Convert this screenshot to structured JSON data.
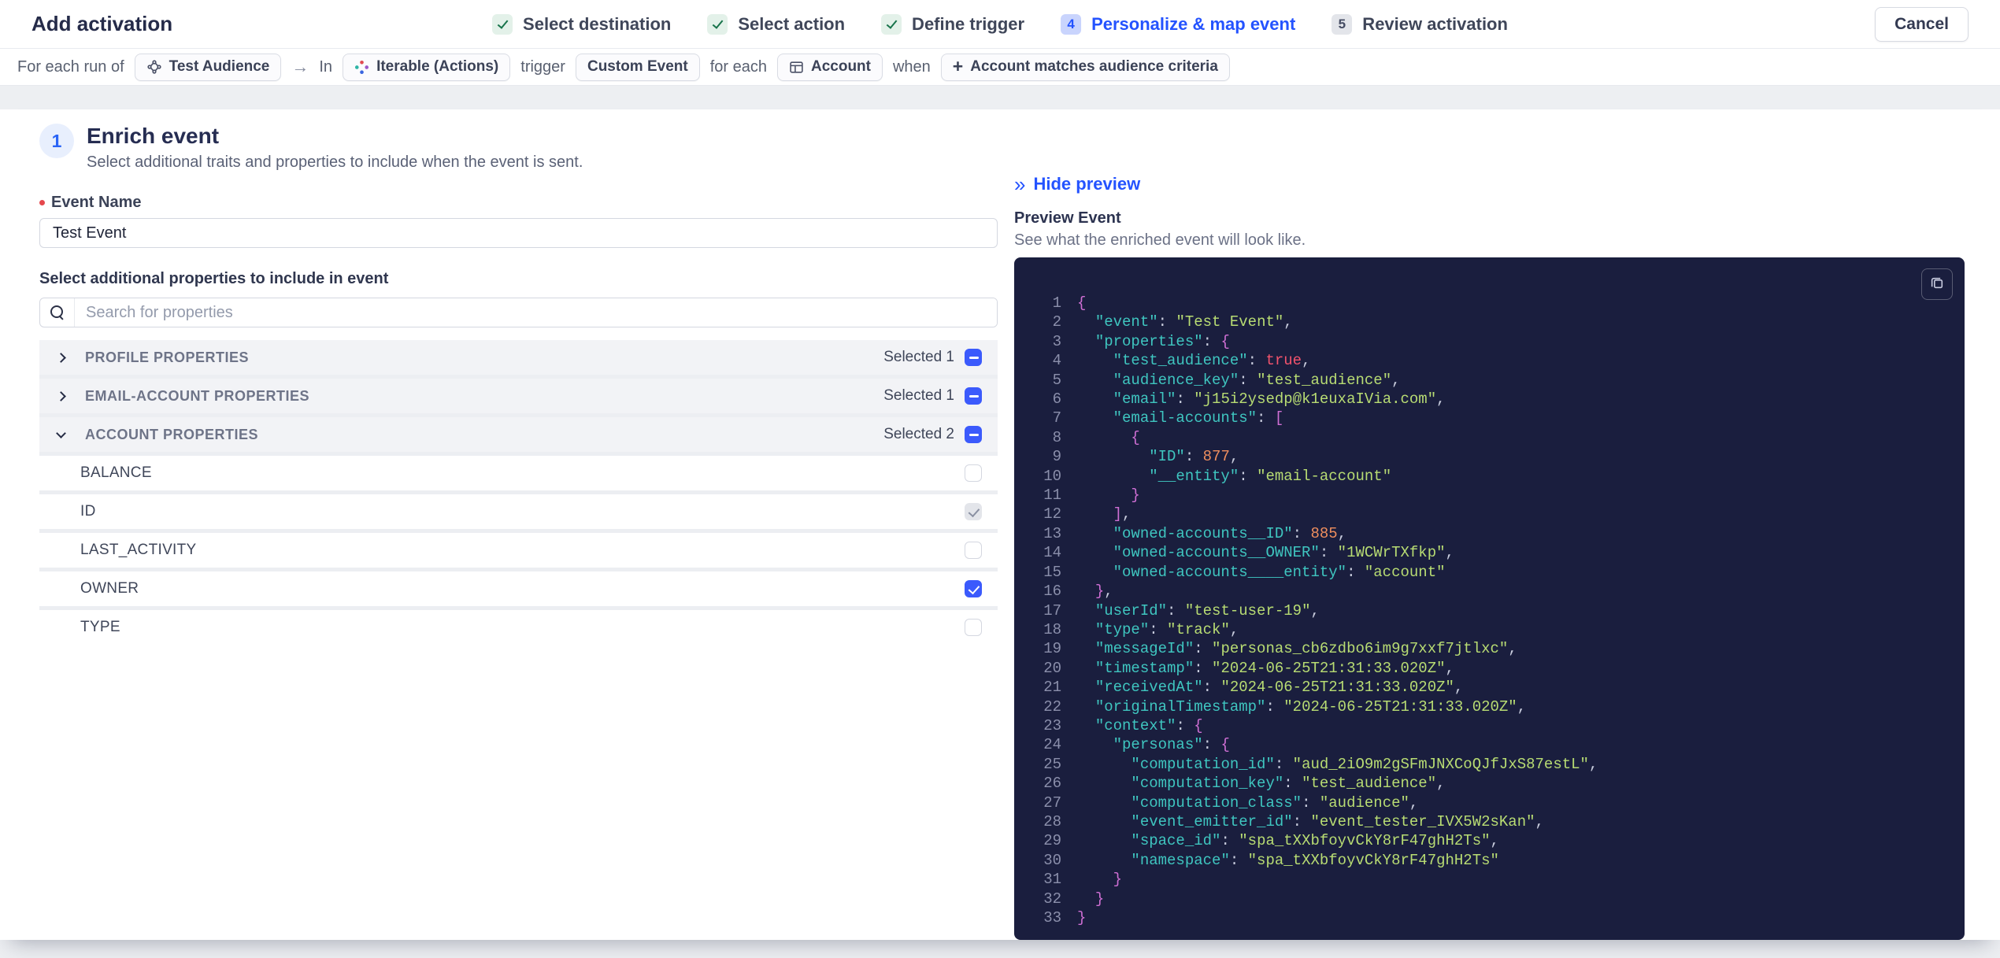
{
  "colors": {
    "accent": "#3b5afc",
    "link": "#2453ff",
    "red_required": "#e5484d",
    "step_done_bg": "#e3f1e9",
    "step_done_check": "#17734a",
    "step_active_bg": "#c9d4fd",
    "step_todo_bg": "#e3e5ea",
    "code_bg": "#1a1e3e",
    "tok_key": "#3fc6c0",
    "tok_string": "#b8dc73",
    "tok_number": "#ef8e5e",
    "tok_boolean": "#f2536d",
    "tok_punct": "#cf6fd4",
    "tok_delim": "#c9cdde",
    "tok_linenum": "#8b8fab"
  },
  "header": {
    "title": "Add activation",
    "cancel_label": "Cancel",
    "steps": [
      {
        "label": "Select destination",
        "state": "done"
      },
      {
        "label": "Select action",
        "state": "done"
      },
      {
        "label": "Define trigger",
        "state": "done"
      },
      {
        "label": "Personalize & map event",
        "state": "active",
        "number": "4"
      },
      {
        "label": "Review activation",
        "state": "todo",
        "number": "5"
      }
    ]
  },
  "summary_bar": {
    "segments": [
      {
        "type": "label",
        "text": "For each run of"
      },
      {
        "type": "chip",
        "icon": "audience-network-icon",
        "text": "Test Audience"
      },
      {
        "type": "arrow",
        "text": "→"
      },
      {
        "type": "label",
        "text": "In"
      },
      {
        "type": "chip",
        "icon": "iterable-logo-icon",
        "text": "Iterable (Actions)"
      },
      {
        "type": "label",
        "text": "trigger"
      },
      {
        "type": "chip",
        "icon": null,
        "text": "Custom Event"
      },
      {
        "type": "label",
        "text": "for each"
      },
      {
        "type": "chip",
        "icon": "table-grid-icon",
        "text": "Account"
      },
      {
        "type": "label",
        "text": "when"
      },
      {
        "type": "chip",
        "icon": "plus-icon",
        "text": "Account matches audience criteria"
      }
    ]
  },
  "enrich": {
    "step_number": "1",
    "title": "Enrich event",
    "subtitle": "Select additional traits and properties to include when the event is sent.",
    "event_name_label": "Event Name",
    "event_name_value": "Test Event",
    "properties_label": "Select additional properties to include in event",
    "search_placeholder": "Search for properties",
    "groups": [
      {
        "label": "PROFILE PROPERTIES",
        "selected_text": "Selected 1",
        "expanded": false
      },
      {
        "label": "EMAIL-ACCOUNT PROPERTIES",
        "selected_text": "Selected 1",
        "expanded": false
      },
      {
        "label": "ACCOUNT PROPERTIES",
        "selected_text": "Selected 2",
        "expanded": true,
        "children": [
          {
            "label": "BALANCE",
            "state": "unchecked"
          },
          {
            "label": "ID",
            "state": "checked-disabled"
          },
          {
            "label": "LAST_ACTIVITY",
            "state": "unchecked"
          },
          {
            "label": "OWNER",
            "state": "checked"
          },
          {
            "label": "TYPE",
            "state": "unchecked"
          }
        ]
      }
    ]
  },
  "preview": {
    "hide_label": "Hide preview",
    "hide_icon": "double-chevron-right-icon",
    "copy_icon": "copy-icon",
    "title": "Preview Event",
    "subtitle": "See what the enriched event will look like.",
    "code_lines": [
      [
        [
          "p",
          "{"
        ]
      ],
      [
        [
          "w",
          "  "
        ],
        [
          "k",
          "\"event\""
        ],
        [
          "d",
          ": "
        ],
        [
          "s",
          "\"Test Event\""
        ],
        [
          "d",
          ","
        ]
      ],
      [
        [
          "w",
          "  "
        ],
        [
          "k",
          "\"properties\""
        ],
        [
          "d",
          ": "
        ],
        [
          "p",
          "{"
        ]
      ],
      [
        [
          "w",
          "    "
        ],
        [
          "k",
          "\"test_audience\""
        ],
        [
          "d",
          ": "
        ],
        [
          "b",
          "true"
        ],
        [
          "d",
          ","
        ]
      ],
      [
        [
          "w",
          "    "
        ],
        [
          "k",
          "\"audience_key\""
        ],
        [
          "d",
          ": "
        ],
        [
          "s",
          "\"test_audience\""
        ],
        [
          "d",
          ","
        ]
      ],
      [
        [
          "w",
          "    "
        ],
        [
          "k",
          "\"email\""
        ],
        [
          "d",
          ": "
        ],
        [
          "s",
          "\"j15i2ysedp@k1euxaIVia.com\""
        ],
        [
          "d",
          ","
        ]
      ],
      [
        [
          "w",
          "    "
        ],
        [
          "k",
          "\"email-accounts\""
        ],
        [
          "d",
          ": "
        ],
        [
          "p",
          "["
        ]
      ],
      [
        [
          "w",
          "      "
        ],
        [
          "p",
          "{"
        ]
      ],
      [
        [
          "w",
          "        "
        ],
        [
          "k",
          "\"ID\""
        ],
        [
          "d",
          ": "
        ],
        [
          "n",
          "877"
        ],
        [
          "d",
          ","
        ]
      ],
      [
        [
          "w",
          "        "
        ],
        [
          "k",
          "\"__entity\""
        ],
        [
          "d",
          ": "
        ],
        [
          "s",
          "\"email-account\""
        ]
      ],
      [
        [
          "w",
          "      "
        ],
        [
          "p",
          "}"
        ]
      ],
      [
        [
          "w",
          "    "
        ],
        [
          "p",
          "]"
        ],
        [
          "d",
          ","
        ]
      ],
      [
        [
          "w",
          "    "
        ],
        [
          "k",
          "\"owned-accounts__ID\""
        ],
        [
          "d",
          ": "
        ],
        [
          "n",
          "885"
        ],
        [
          "d",
          ","
        ]
      ],
      [
        [
          "w",
          "    "
        ],
        [
          "k",
          "\"owned-accounts__OWNER\""
        ],
        [
          "d",
          ": "
        ],
        [
          "s",
          "\"1WCWrTXfkp\""
        ],
        [
          "d",
          ","
        ]
      ],
      [
        [
          "w",
          "    "
        ],
        [
          "k",
          "\"owned-accounts____entity\""
        ],
        [
          "d",
          ": "
        ],
        [
          "s",
          "\"account\""
        ]
      ],
      [
        [
          "w",
          "  "
        ],
        [
          "p",
          "}"
        ],
        [
          "d",
          ","
        ]
      ],
      [
        [
          "w",
          "  "
        ],
        [
          "k",
          "\"userId\""
        ],
        [
          "d",
          ": "
        ],
        [
          "s",
          "\"test-user-19\""
        ],
        [
          "d",
          ","
        ]
      ],
      [
        [
          "w",
          "  "
        ],
        [
          "k",
          "\"type\""
        ],
        [
          "d",
          ": "
        ],
        [
          "s",
          "\"track\""
        ],
        [
          "d",
          ","
        ]
      ],
      [
        [
          "w",
          "  "
        ],
        [
          "k",
          "\"messageId\""
        ],
        [
          "d",
          ": "
        ],
        [
          "s",
          "\"personas_cb6zdbo6im9g7xxf7jtlxc\""
        ],
        [
          "d",
          ","
        ]
      ],
      [
        [
          "w",
          "  "
        ],
        [
          "k",
          "\"timestamp\""
        ],
        [
          "d",
          ": "
        ],
        [
          "s",
          "\"2024-06-25T21:31:33.020Z\""
        ],
        [
          "d",
          ","
        ]
      ],
      [
        [
          "w",
          "  "
        ],
        [
          "k",
          "\"receivedAt\""
        ],
        [
          "d",
          ": "
        ],
        [
          "s",
          "\"2024-06-25T21:31:33.020Z\""
        ],
        [
          "d",
          ","
        ]
      ],
      [
        [
          "w",
          "  "
        ],
        [
          "k",
          "\"originalTimestamp\""
        ],
        [
          "d",
          ": "
        ],
        [
          "s",
          "\"2024-06-25T21:31:33.020Z\""
        ],
        [
          "d",
          ","
        ]
      ],
      [
        [
          "w",
          "  "
        ],
        [
          "k",
          "\"context\""
        ],
        [
          "d",
          ": "
        ],
        [
          "p",
          "{"
        ]
      ],
      [
        [
          "w",
          "    "
        ],
        [
          "k",
          "\"personas\""
        ],
        [
          "d",
          ": "
        ],
        [
          "p",
          "{"
        ]
      ],
      [
        [
          "w",
          "      "
        ],
        [
          "k",
          "\"computation_id\""
        ],
        [
          "d",
          ": "
        ],
        [
          "s",
          "\"aud_2iO9m2gSFmJNXCoQJfJxS87estL\""
        ],
        [
          "d",
          ","
        ]
      ],
      [
        [
          "w",
          "      "
        ],
        [
          "k",
          "\"computation_key\""
        ],
        [
          "d",
          ": "
        ],
        [
          "s",
          "\"test_audience\""
        ],
        [
          "d",
          ","
        ]
      ],
      [
        [
          "w",
          "      "
        ],
        [
          "k",
          "\"computation_class\""
        ],
        [
          "d",
          ": "
        ],
        [
          "s",
          "\"audience\""
        ],
        [
          "d",
          ","
        ]
      ],
      [
        [
          "w",
          "      "
        ],
        [
          "k",
          "\"event_emitter_id\""
        ],
        [
          "d",
          ": "
        ],
        [
          "s",
          "\"event_tester_IVX5W2sKan\""
        ],
        [
          "d",
          ","
        ]
      ],
      [
        [
          "w",
          "      "
        ],
        [
          "k",
          "\"space_id\""
        ],
        [
          "d",
          ": "
        ],
        [
          "s",
          "\"spa_tXXbfoyvCkY8rF47ghH2Ts\""
        ],
        [
          "d",
          ","
        ]
      ],
      [
        [
          "w",
          "      "
        ],
        [
          "k",
          "\"namespace\""
        ],
        [
          "d",
          ": "
        ],
        [
          "s",
          "\"spa_tXXbfoyvCkY8rF47ghH2Ts\""
        ]
      ],
      [
        [
          "w",
          "    "
        ],
        [
          "p",
          "}"
        ]
      ],
      [
        [
          "w",
          "  "
        ],
        [
          "p",
          "}"
        ]
      ],
      [
        [
          "p",
          "}"
        ]
      ]
    ]
  }
}
